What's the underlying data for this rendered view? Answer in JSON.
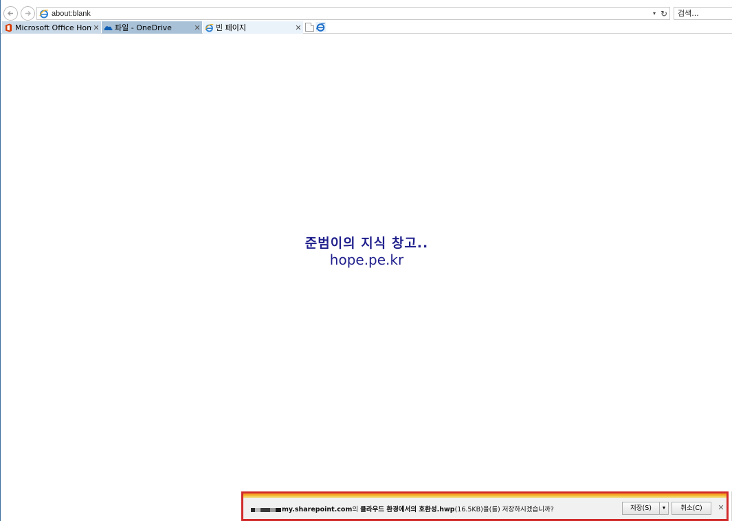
{
  "browser": {
    "address": "about:blank",
    "search_placeholder": "검색...",
    "tabs": [
      {
        "label": "Microsoft Office Home",
        "close": "✕"
      },
      {
        "label": "파일 - OneDrive",
        "close": "✕"
      },
      {
        "label": "빈 페이지",
        "close": "✕"
      }
    ],
    "icons": {
      "back": "back-arrow-icon",
      "forward": "forward-arrow-icon",
      "address_dropdown": "▾",
      "refresh": "↻"
    }
  },
  "content": {
    "line1": "준범이의 지식 창고..",
    "line2": "hope.pe.kr",
    "text_color": "#1f1f8c"
  },
  "download_bar": {
    "domain": "my.sharepoint.com",
    "msg_part1": "의 ",
    "filename": "클라우드 환경에서의 호환성.hwp",
    "size": "(16.5KB)",
    "msg_part2": "을(를) 저장하시겠습니까?",
    "save_label": "저장(S)",
    "save_dropdown": "▼",
    "cancel_label": "취소(C)",
    "close": "✕",
    "highlight_color": "#d12a2a"
  }
}
